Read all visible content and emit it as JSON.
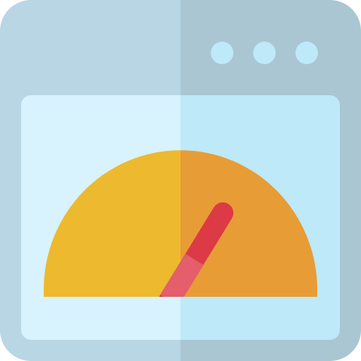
{
  "icon": {
    "name": "browser-speed-test-icon",
    "colors": {
      "frame_left": "#b8d6e4",
      "frame_right": "#aac6d3",
      "window_dot": "#bde9f9",
      "screen_left": "#d8f3fd",
      "screen_right": "#bde9f8",
      "gauge_left": "#edb92e",
      "gauge_right": "#e89c35",
      "needle": "#dc3a45",
      "needle_base": "#e45e6b"
    },
    "window_dots": [
      "dot",
      "dot",
      "dot"
    ],
    "gauge": {
      "needle_level": 0.7
    }
  }
}
